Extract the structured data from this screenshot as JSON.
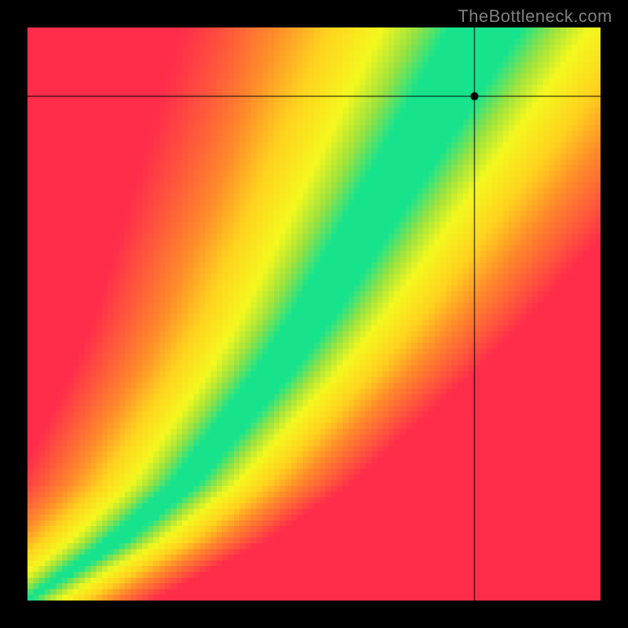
{
  "watermark": "TheBottleneck.com",
  "chart_data": {
    "type": "heatmap",
    "title": "",
    "xlabel": "",
    "ylabel": "",
    "xlim": [
      0,
      100
    ],
    "ylim": [
      0,
      100
    ],
    "grid_resolution": 100,
    "crosshair": {
      "x": 78,
      "y": 88
    },
    "marker": {
      "x": 78,
      "y": 88
    },
    "optimal_band": {
      "description": "green optimal ridge (x as function of y)",
      "points": [
        {
          "y": 0,
          "x_center": 0,
          "width": 1
        },
        {
          "y": 10,
          "x_center": 15,
          "width": 4
        },
        {
          "y": 20,
          "x_center": 27,
          "width": 5
        },
        {
          "y": 30,
          "x_center": 35,
          "width": 6
        },
        {
          "y": 40,
          "x_center": 43,
          "width": 7
        },
        {
          "y": 50,
          "x_center": 50,
          "width": 8
        },
        {
          "y": 60,
          "x_center": 56,
          "width": 9
        },
        {
          "y": 70,
          "x_center": 62,
          "width": 10
        },
        {
          "y": 80,
          "x_center": 68,
          "width": 11
        },
        {
          "y": 90,
          "x_center": 74,
          "width": 12
        },
        {
          "y": 100,
          "x_center": 80,
          "width": 13
        }
      ]
    },
    "color_scale": [
      {
        "value": 0.0,
        "color": "#ff2d4a"
      },
      {
        "value": 0.35,
        "color": "#ff8a2a"
      },
      {
        "value": 0.55,
        "color": "#ffd21e"
      },
      {
        "value": 0.75,
        "color": "#f4f81e"
      },
      {
        "value": 0.88,
        "color": "#9be23f"
      },
      {
        "value": 1.0,
        "color": "#18e38d"
      }
    ]
  }
}
